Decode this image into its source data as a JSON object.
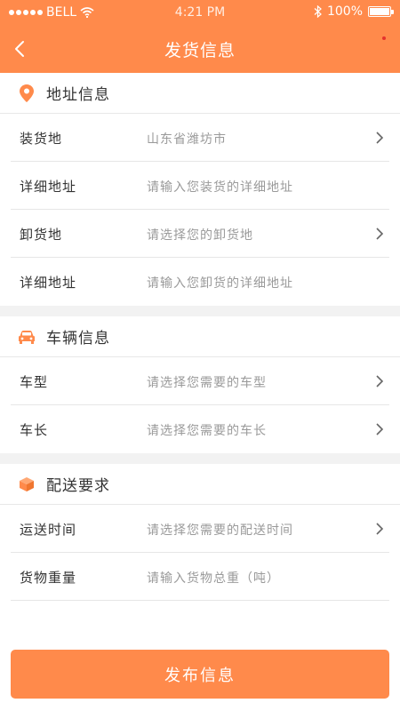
{
  "status_bar": {
    "carrier": "BELL",
    "time": "4:21 PM",
    "battery": "100%"
  },
  "nav": {
    "title": "发货信息"
  },
  "sections": [
    {
      "title": "地址信息",
      "icon": "location-pin-icon",
      "rows": [
        {
          "label": "装货地",
          "value": "山东省潍坊市",
          "has_arrow": true
        },
        {
          "label": "详细地址",
          "value": "请输入您装货的详细地址",
          "has_arrow": false
        },
        {
          "label": "卸货地",
          "value": "请选择您的卸货地",
          "has_arrow": true
        },
        {
          "label": "详细地址",
          "value": "请输入您卸货的详细地址",
          "has_arrow": false
        }
      ]
    },
    {
      "title": "车辆信息",
      "icon": "car-icon",
      "rows": [
        {
          "label": "车型",
          "value": "请选择您需要的车型",
          "has_arrow": true
        },
        {
          "label": "车长",
          "value": "请选择您需要的车长",
          "has_arrow": true
        }
      ]
    },
    {
      "title": "配送要求",
      "icon": "package-box-icon",
      "rows": [
        {
          "label": "运送时间",
          "value": "请选择您需要的配送时间",
          "has_arrow": true
        },
        {
          "label": "货物重量",
          "value": "请输入货物总重（吨）",
          "has_arrow": false
        }
      ]
    }
  ],
  "submit_label": "发布信息",
  "colors": {
    "accent": "#ff8a4b",
    "label_text": "#333333",
    "placeholder_text": "#9a9a9a"
  }
}
